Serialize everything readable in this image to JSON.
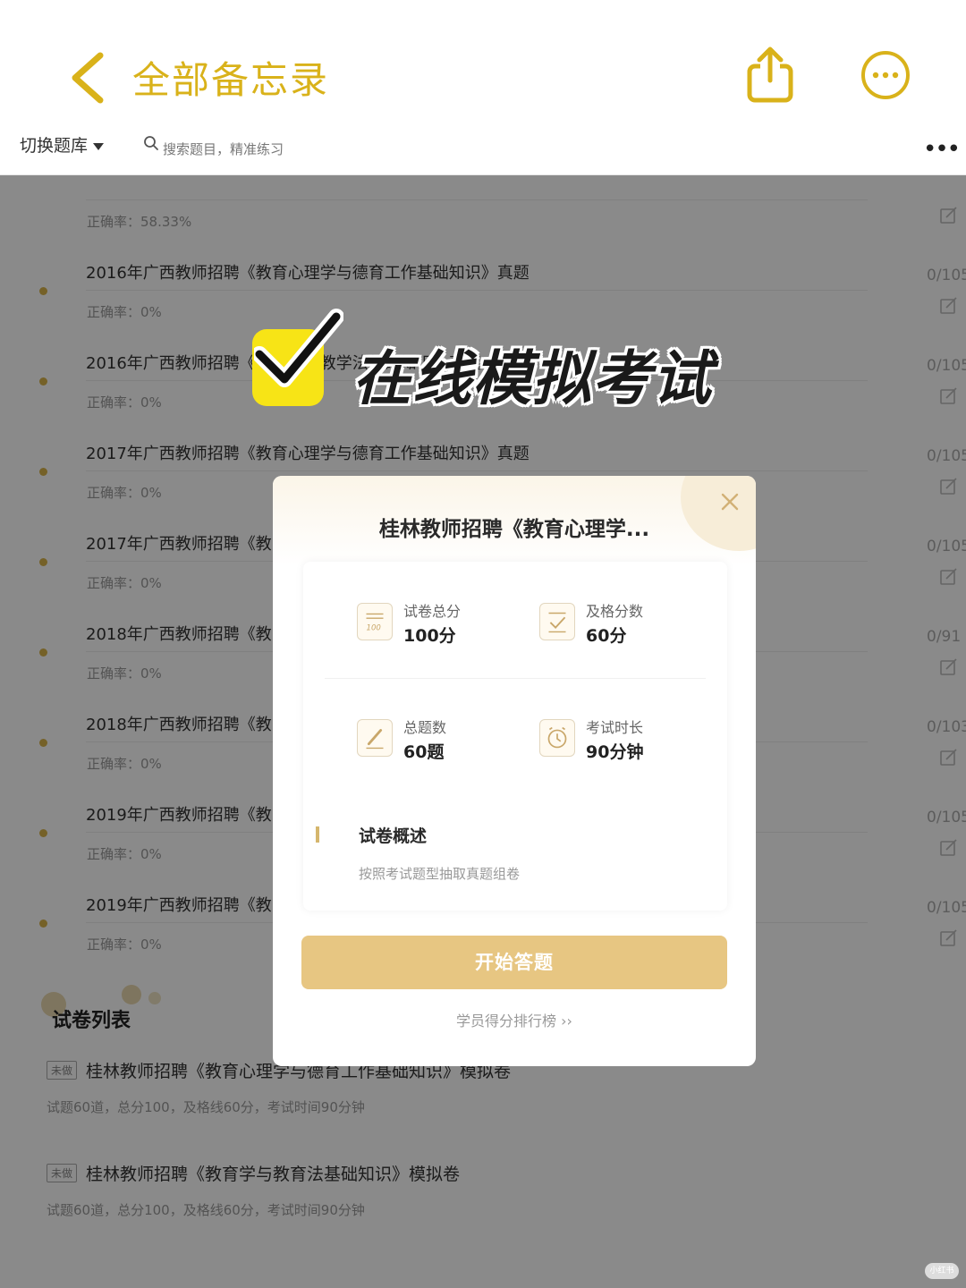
{
  "topbar": {
    "title": "全部备忘录",
    "accent_color": "#d9b21a",
    "icons": [
      "chevron-left-icon",
      "share-icon",
      "more-circle-icon"
    ]
  },
  "appbar": {
    "switch_label": "切换题库",
    "search_placeholder": "搜索题目，精准练习",
    "more_label": "•••"
  },
  "list": [
    {
      "title": "",
      "accuracy": "正确率：58.33%",
      "count": ""
    },
    {
      "title": "2016年广西教师招聘《教育心理学与德育工作基础知识》真题",
      "accuracy": "正确率：0%",
      "count": "0/105"
    },
    {
      "title": "2016年广西教师招聘《教育学与教学法基础知识》真题",
      "accuracy": "正确率：0%",
      "count": "0/105"
    },
    {
      "title": "2017年广西教师招聘《教育心理学与德育工作基础知识》真题",
      "accuracy": "正确率：0%",
      "count": "0/105"
    },
    {
      "title": "2017年广西教师招聘《教",
      "accuracy": "正确率：0%",
      "count": "0/105"
    },
    {
      "title": "2018年广西教师招聘《教",
      "accuracy": "正确率：0%",
      "count": "0/91"
    },
    {
      "title": "2018年广西教师招聘《教",
      "accuracy": "正确率：0%",
      "count": "0/103"
    },
    {
      "title": "2019年广西教师招聘《教",
      "accuracy": "正确率：0%",
      "count": "0/105"
    },
    {
      "title": "2019年广西教师招聘《教",
      "accuracy": "正确率：0%",
      "count": "0/105"
    }
  ],
  "papers": {
    "section_title": "试卷列表",
    "items": [
      {
        "badge": "未做",
        "title": "桂林教师招聘《教育心理学与德育工作基础知识》模拟卷",
        "meta": "试题60道，总分100，及格线60分，考试时间90分钟"
      },
      {
        "badge": "未做",
        "title": "桂林教师招聘《教育学与教育法基础知识》模拟卷",
        "meta": "试题60道，总分100，及格线60分，考试时间90分钟"
      }
    ]
  },
  "promo": {
    "text": "在线模拟考试",
    "checkbox_color": "#f7e416"
  },
  "modal": {
    "title": "桂林教师招聘《教育心理学...",
    "stats": [
      {
        "icon": "score-sheet-icon",
        "label": "试卷总分",
        "value": "100分"
      },
      {
        "icon": "pass-check-icon",
        "label": "及格分数",
        "value": "60分"
      },
      {
        "icon": "pencil-icon",
        "label": "总题数",
        "value": "60题"
      },
      {
        "icon": "alarm-clock-icon",
        "label": "考试时长",
        "value": "90分钟"
      }
    ],
    "overview_title": "试卷概述",
    "overview_desc": "按照考试题型抽取真题组卷",
    "start_button": "开始答题",
    "start_button_color": "#e7c682",
    "rank_link": "学员得分排行榜 ››"
  },
  "watermark": "小红书"
}
